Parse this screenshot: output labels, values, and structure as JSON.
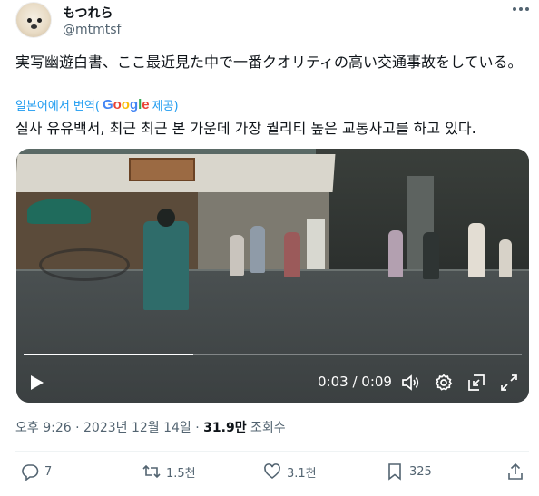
{
  "author": {
    "display_name": "もつれら",
    "handle": "@mtmtsf"
  },
  "tweet": {
    "text": "実写幽遊白書、ここ最近見た中で一番クオリティの高い交通事故をしている。",
    "translate_prefix": "일본어에서 번역(",
    "translate_brand": "Google",
    "translate_suffix": " 제공)",
    "translated_text": "실사 유유백서, 최근 최근 본 가운데 가장 퀄리티 높은 교통사고를 하고 있다."
  },
  "video": {
    "time_readout": "0:03 / 0:09",
    "progress_fraction": 0.34
  },
  "meta": {
    "timestamp": "오후 9:26 · 2023년 12월 14일 · ",
    "views_count": "31.9만",
    "views_label": " 조회수"
  },
  "actions": {
    "replies": "7",
    "reposts": "1.5천",
    "likes": "3.1천",
    "bookmarks": "325"
  },
  "colors": {
    "link": "#1d9bf0",
    "secondary_text": "#536471",
    "primary_text": "#0f1419"
  }
}
